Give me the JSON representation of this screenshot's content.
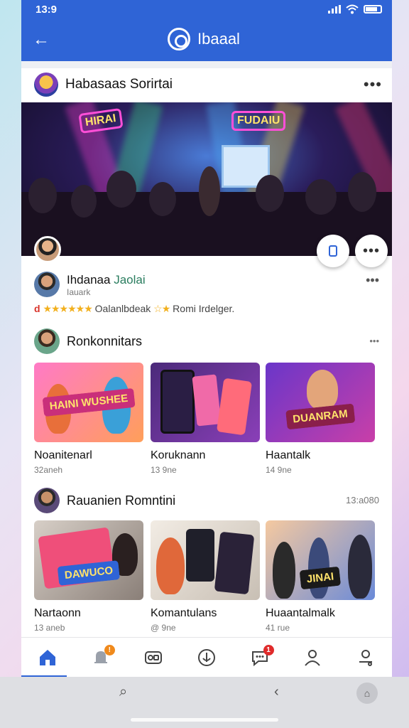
{
  "status_bar": {
    "time": "13:9"
  },
  "app_bar": {
    "title": "Ibaaal"
  },
  "post": {
    "author": "Habasaas Sorirtai",
    "more_label": "•••"
  },
  "profile": {
    "name_main": "Ihdanaa",
    "name_accent": "Jaolai",
    "subtitle": "Iauark",
    "more_label": "•••"
  },
  "rating": {
    "prefix": "d",
    "stars_a": "★★★★★★",
    "text": "Oalanlbdeak",
    "stars_b": "☆★",
    "suffix": "Romi Irdelger."
  },
  "section1": {
    "title": "Ronkonnitars",
    "more_label": "•••",
    "cards": [
      {
        "title": "Noanitenarl",
        "sub": "32aneh",
        "badge": "HAINI WUSHEE"
      },
      {
        "title": "Koruknann",
        "sub": "13 9ne",
        "badge": ""
      },
      {
        "title": "Haantalk",
        "sub": "14 9ne",
        "badge": "DUANRAM"
      }
    ]
  },
  "section2": {
    "title": "Rauanien Romntini",
    "right_text": "13:a080",
    "cards": [
      {
        "title": "Nartaonn",
        "sub": "13 aneb",
        "badge": "DAWUCO"
      },
      {
        "title": "Komantulans",
        "sub": "@ 9ne",
        "badge": ""
      },
      {
        "title": "Huaantalmalk",
        "sub": "41 rue",
        "badge": "JINAI"
      }
    ]
  },
  "bottom_nav": {
    "items": [
      "home",
      "bell",
      "media",
      "anchor",
      "chat",
      "profile",
      "settings"
    ],
    "bell_badge": "!",
    "chat_badge": "1",
    "accent": "#2f64d6",
    "badge_orange": "#f08a1c",
    "badge_red": "#e02b2b"
  }
}
